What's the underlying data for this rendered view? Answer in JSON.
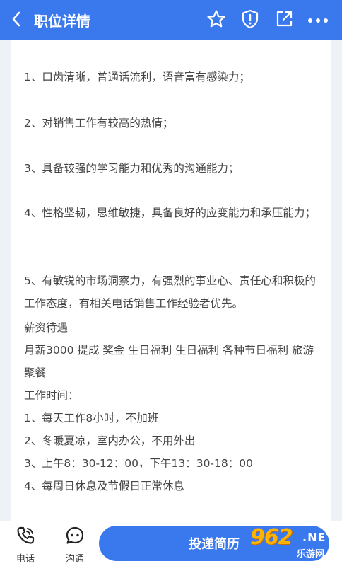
{
  "header": {
    "title": "职位详情",
    "icons": [
      "back-arrow-icon",
      "star-icon",
      "report-icon",
      "share-icon",
      "more-icon"
    ]
  },
  "requirements": [
    "1、口齿清晰，普通话流利，语音富有感染力；",
    "2、对销售工作有较高的热情；",
    "3、具备较强的学习能力和优秀的沟通能力；",
    "4、性格坚韧，思维敏捷，具备良好的应变能力和承压能力；",
    "5、有敏锐的市场洞察力，有强烈的事业心、责任心和积极的工作态度，有相关电话销售工作经验者优先。"
  ],
  "salary": {
    "heading": "薪资待遇",
    "details": "月薪3000 提成 奖金 生日福利 生日福利 各种节日福利 旅游 聚餐"
  },
  "work_time": {
    "heading": "工作时间：",
    "items": [
      "1、每天工作8小时，不加班",
      "2、冬暖夏凉，室内办公，不用外出",
      "3、上午8：30-12：00，下午13：30-18：00",
      "4、每周日休息及节假日正常休息"
    ]
  },
  "footer": {
    "phone_label": "电话",
    "chat_label": "沟通",
    "apply_label": "投递简历"
  },
  "watermark": {
    "number": "962",
    "suffix": ".NET",
    "site": "乐游网"
  },
  "colors": {
    "primary": "#3a78ee",
    "background": "#eef1f5",
    "watermark": "#ffb200"
  }
}
